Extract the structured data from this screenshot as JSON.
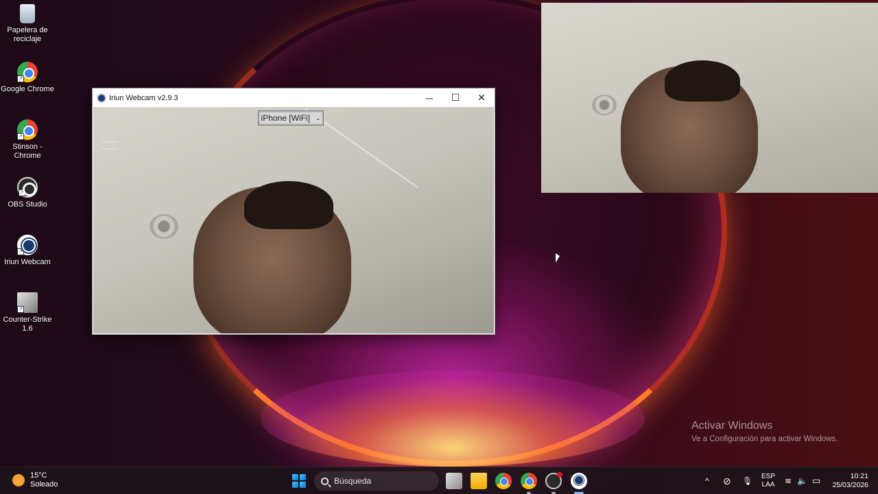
{
  "desktop": {
    "icons": [
      {
        "label": "Papelera de reciclaje",
        "icon": "recycle-bin-icon"
      },
      {
        "label": "Google Chrome",
        "icon": "chrome-icon"
      },
      {
        "label": "Stinson - Chrome",
        "icon": "chrome-profile-icon"
      },
      {
        "label": "OBS Studio",
        "icon": "obs-icon"
      },
      {
        "label": "Iriun Webcam",
        "icon": "iriun-icon"
      },
      {
        "label": "Counter-Strike 1.6",
        "icon": "counter-strike-icon"
      }
    ]
  },
  "window": {
    "title": "Iriun Webcam v2.9.3",
    "device_select": "iPhone [WiFi]",
    "minimize": "─",
    "maximize": "☐",
    "close": "✕"
  },
  "activation": {
    "title": "Activar Windows",
    "subtitle": "Ve a Configuración para activar Windows."
  },
  "taskbar": {
    "weather_temp": "15°C",
    "weather_desc": "Soleado",
    "search_placeholder": "Búsqueda",
    "lang_1": "ESP",
    "lang_2": "LAA",
    "time": "10:21",
    "date": "25/03/2026",
    "chevron": "^",
    "mic": "🎙",
    "volume": "🔈",
    "wifi": "≋"
  }
}
